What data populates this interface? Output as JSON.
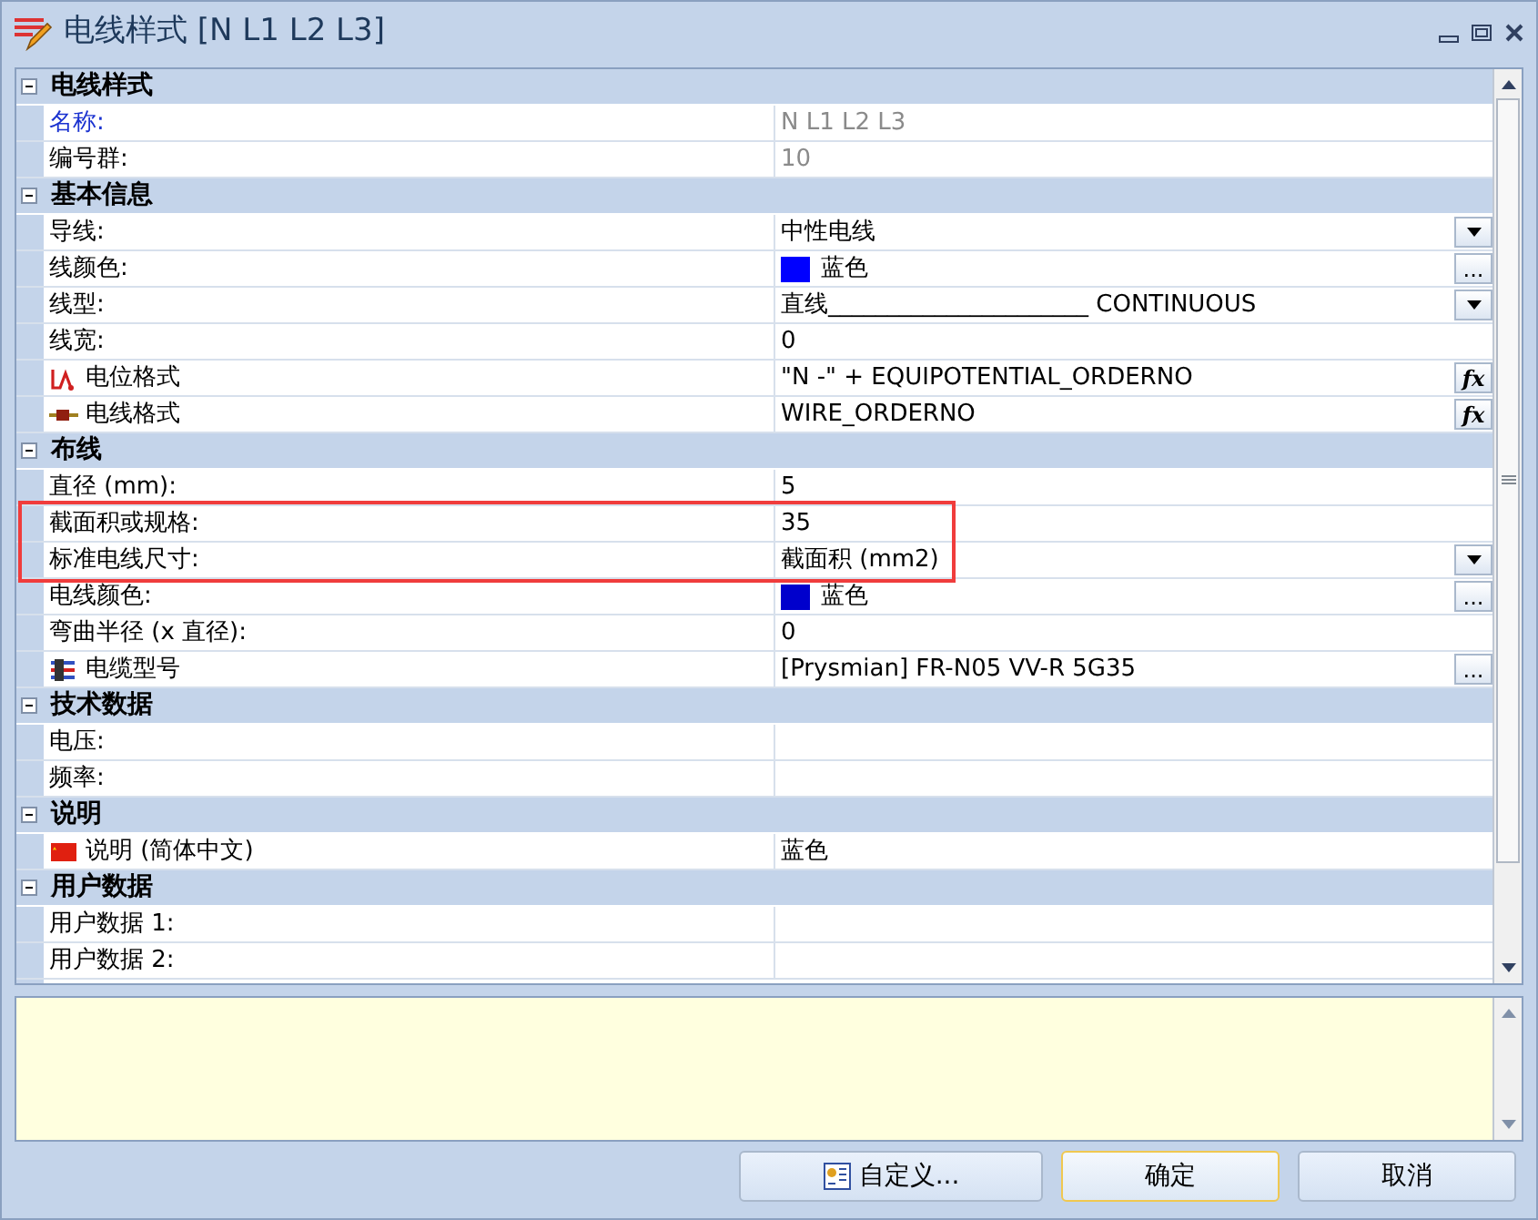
{
  "window": {
    "title": "电线样式 [N L1 L2 L3]"
  },
  "groups": [
    {
      "title": "电线样式",
      "expanded": true,
      "rows": [
        {
          "label": "名称:",
          "value": "N L1 L2 L3",
          "readonly": true,
          "selected": true,
          "kind": "text"
        },
        {
          "label": "编号群:",
          "value": "10",
          "readonly": true,
          "selected": false,
          "kind": "text"
        }
      ]
    },
    {
      "title": "基本信息",
      "expanded": true,
      "rows": [
        {
          "label": "导线:",
          "value": "中性电线",
          "selected": false,
          "kind": "dropdown"
        },
        {
          "label": "线颜色:",
          "value": "蓝色",
          "color": "#0000ff",
          "selected": false,
          "kind": "picker",
          "button": "..."
        },
        {
          "label": "线型:",
          "value": "直线______________________ CONTINUOUS",
          "selected": false,
          "kind": "dropdown"
        },
        {
          "label": "线宽:",
          "value": "0",
          "selected": false,
          "kind": "text"
        },
        {
          "label": "电位格式",
          "icon": {
            "kind": "potential"
          },
          "value": "\"N -\" + EQUIPOTENTIAL_ORDERNO",
          "selected": false,
          "kind": "formula",
          "button": "fx"
        },
        {
          "label": "电线格式",
          "icon": {
            "kind": "wire"
          },
          "value": "WIRE_ORDERNO",
          "selected": false,
          "kind": "formula",
          "button": "fx"
        }
      ]
    },
    {
      "title": "布线",
      "expanded": true,
      "rows": [
        {
          "label": "直径 (mm):",
          "value": "5",
          "selected": false,
          "kind": "text"
        },
        {
          "label": "截面积或规格:",
          "value": "35",
          "selected": false,
          "highlighted": true,
          "kind": "text"
        },
        {
          "label": "标准电线尺寸:",
          "value": "截面积 (mm2)",
          "selected": false,
          "highlighted": true,
          "kind": "dropdown"
        },
        {
          "label": "电线颜色:",
          "value": "蓝色",
          "color": "#0000cc",
          "selected": false,
          "kind": "picker",
          "button": "..."
        },
        {
          "label": "弯曲半径 (x 直径):",
          "value": "0",
          "selected": false,
          "kind": "text"
        },
        {
          "label": "电缆型号",
          "icon": {
            "kind": "cable"
          },
          "value": "[Prysmian] FR-N05 VV-R 5G35",
          "selected": false,
          "kind": "picker",
          "button": "..."
        }
      ]
    },
    {
      "title": "技术数据",
      "expanded": true,
      "rows": [
        {
          "label": "电压:",
          "selected": false,
          "kind": "text"
        },
        {
          "label": "频率:",
          "selected": false,
          "kind": "text"
        }
      ]
    },
    {
      "title": "说明",
      "expanded": true,
      "rows": [
        {
          "label": "说明 (简体中文)",
          "icon": {
            "kind": "flag"
          },
          "value": "蓝色",
          "selected": false,
          "kind": "text"
        }
      ]
    },
    {
      "title": "用户数据",
      "expanded": true,
      "rows": [
        {
          "label": "用户数据 1:",
          "selected": false,
          "kind": "text"
        },
        {
          "label": "用户数据 2:",
          "selected": false,
          "kind": "text"
        }
      ]
    }
  ],
  "buttons": [
    {
      "label": "自定义...",
      "icon": true,
      "default": false
    },
    {
      "label": "确定",
      "default": true
    },
    {
      "label": "取消",
      "default": false
    }
  ]
}
